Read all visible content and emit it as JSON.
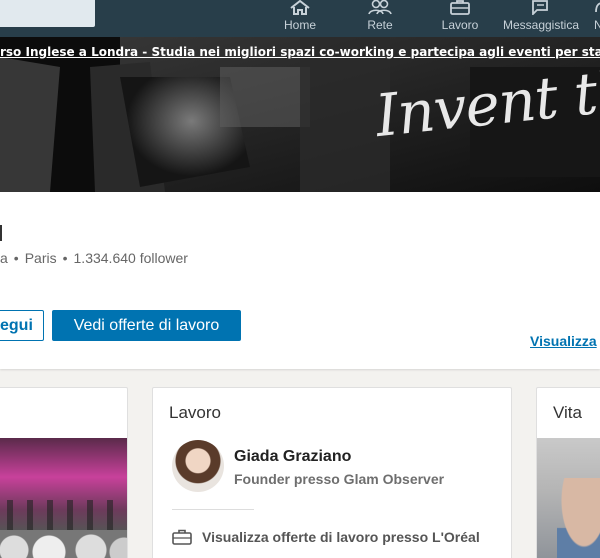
{
  "nav": {
    "items": [
      {
        "label": "Home",
        "icon": "home-icon"
      },
      {
        "label": "Rete",
        "icon": "network-icon"
      },
      {
        "label": "Lavoro",
        "icon": "briefcase-icon"
      },
      {
        "label": "Messaggistica",
        "icon": "messaging-icon"
      },
      {
        "label": "N",
        "icon": "notifications-icon"
      }
    ]
  },
  "cover": {
    "banner_text": "rso Inglese a Londra - Studia nei migliori spazi co-working e partecipa agli eventi per startup",
    "script_text": "Invent the"
  },
  "company": {
    "meta": {
      "part1": "a",
      "location": "Paris",
      "followers": "1.334.640 follower"
    },
    "follow_label": "egui",
    "jobs_button_label": "Vedi offerte di lavoro",
    "view_link_label": "Visualizza"
  },
  "cards": {
    "jobs": {
      "title": "Lavoro",
      "person_name": "Giada Graziano",
      "person_role": "Founder presso Glam Observer",
      "jobs_link": "Visualizza offerte di lavoro presso L'Oréal"
    },
    "life": {
      "title": "Vita"
    }
  },
  "colors": {
    "nav_bg": "#283e4a",
    "accent": "#0073b1"
  }
}
